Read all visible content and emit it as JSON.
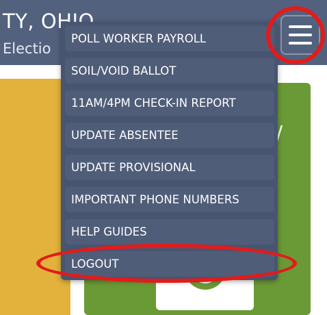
{
  "header": {
    "title": "TY, OHIO",
    "subtitle": "Electio"
  },
  "background": {
    "slash": "/"
  },
  "menu": {
    "button_icon": "hamburger-menu-icon",
    "items": [
      {
        "label": "POLL WORKER PAYROLL"
      },
      {
        "label": "SOIL/VOID BALLOT"
      },
      {
        "label": "11AM/4PM CHECK-IN REPORT"
      },
      {
        "label": "UPDATE ABSENTEE"
      },
      {
        "label": "UPDATE PROVISIONAL"
      },
      {
        "label": "IMPORTANT PHONE NUMBERS"
      },
      {
        "label": "HELP GUIDES"
      },
      {
        "label": "LOGOUT"
      }
    ]
  },
  "colors": {
    "header": "#52617e",
    "menu_background": "#475570",
    "menu_item": "#4f5d78",
    "yellow_panel": "#e2b23c",
    "green_panel": "#6a9a35",
    "highlight_ring": "#e21b1b"
  }
}
